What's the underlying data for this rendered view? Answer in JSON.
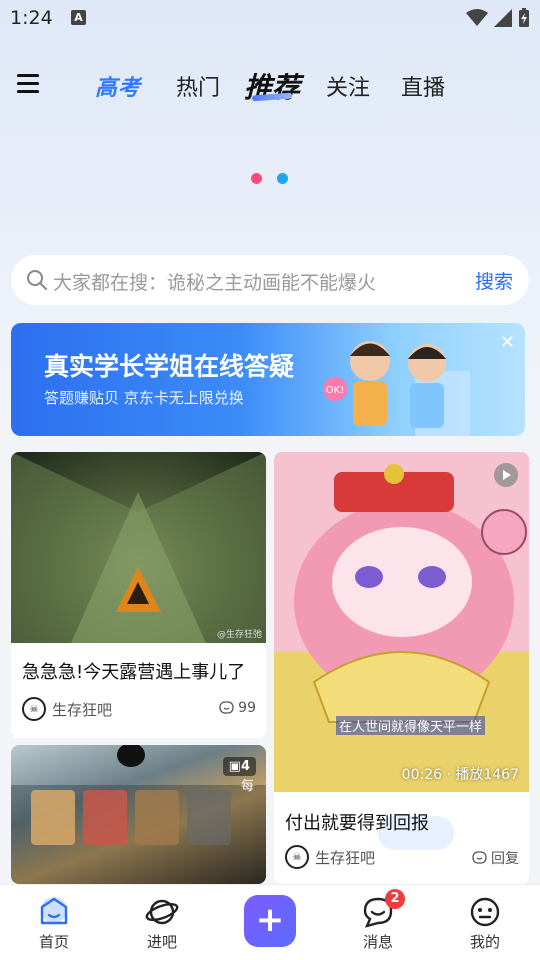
{
  "status_bar": {
    "time": "1:24",
    "app_indicator": "A"
  },
  "top_nav": {
    "tabs": [
      {
        "label": "高考"
      },
      {
        "label": "热门"
      },
      {
        "label": "推荐"
      },
      {
        "label": "关注"
      },
      {
        "label": "直播"
      }
    ],
    "active_tab": "推荐"
  },
  "search": {
    "placeholder": "大家都在搜：诡秘之主动画能不能爆火",
    "button_label": "搜索"
  },
  "banner": {
    "title": "真实学长学姐在线答疑",
    "subtitle": "答题赚贴贝  京东卡无上限兑换",
    "sticker": "OK!"
  },
  "feed": {
    "card1": {
      "watermark": "@生存狂弛",
      "title": "急急急!今天露营遇上事儿了",
      "author": "生存狂吧",
      "comments": "99"
    },
    "card2": {
      "caption": "在人世间就得像天平一样",
      "video_meta": "00:26 · 播放1467",
      "title": "付出就要得到回报",
      "author": "生存狂吧",
      "action": "回复"
    },
    "card3": {
      "image_count": "4",
      "corner_text": "每"
    }
  },
  "bottom_bar": {
    "tabs": [
      {
        "label": "首页"
      },
      {
        "label": "进吧"
      },
      {
        "label": "消息",
        "badge": "2"
      },
      {
        "label": "我的"
      }
    ],
    "plus": "+"
  },
  "colors": {
    "accent": "#2f7bff",
    "badge": "#f23c3c",
    "plus_gradient_start": "#7f5bff"
  }
}
